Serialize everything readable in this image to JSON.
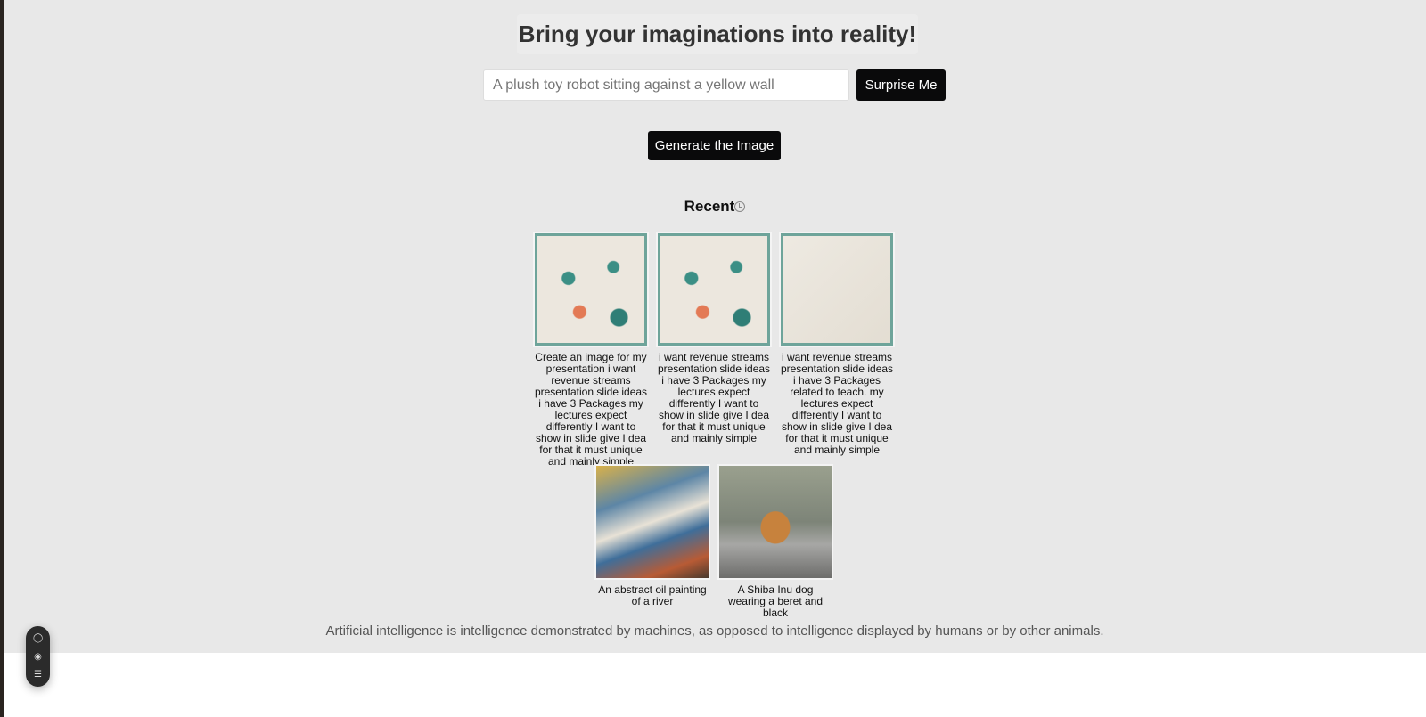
{
  "header": {
    "title": "Bring your imaginations into reality!"
  },
  "prompt": {
    "placeholder": "A plush toy robot sitting against a yellow wall"
  },
  "buttons": {
    "surprise": "Surprise Me",
    "generate": "Generate the Image"
  },
  "recent": {
    "label": "Recent",
    "items": [
      {
        "caption": "Create an image for my presentation i want revenue streams presentation slide ideas i have 3 Packages my lectures expect differently I want to show in slide give I dea for that it must unique and mainly simple"
      },
      {
        "caption": "i want revenue streams presentation slide ideas i have 3 Packages my lectures expect differently I want to show in slide give I dea for that it must unique and mainly simple"
      },
      {
        "caption": "i want revenue streams presentation slide ideas i have 3 Packages related to teach. my lectures expect differently I want to show in slide give I dea for that it must unique and mainly simple"
      },
      {
        "caption": "An abstract oil painting of a river"
      },
      {
        "caption": "A Shiba Inu dog wearing a beret and black"
      }
    ]
  },
  "footer": {
    "text": "Artificial intelligence is intelligence demonstrated by machines, as opposed to intelligence displayed by humans or by other animals."
  }
}
